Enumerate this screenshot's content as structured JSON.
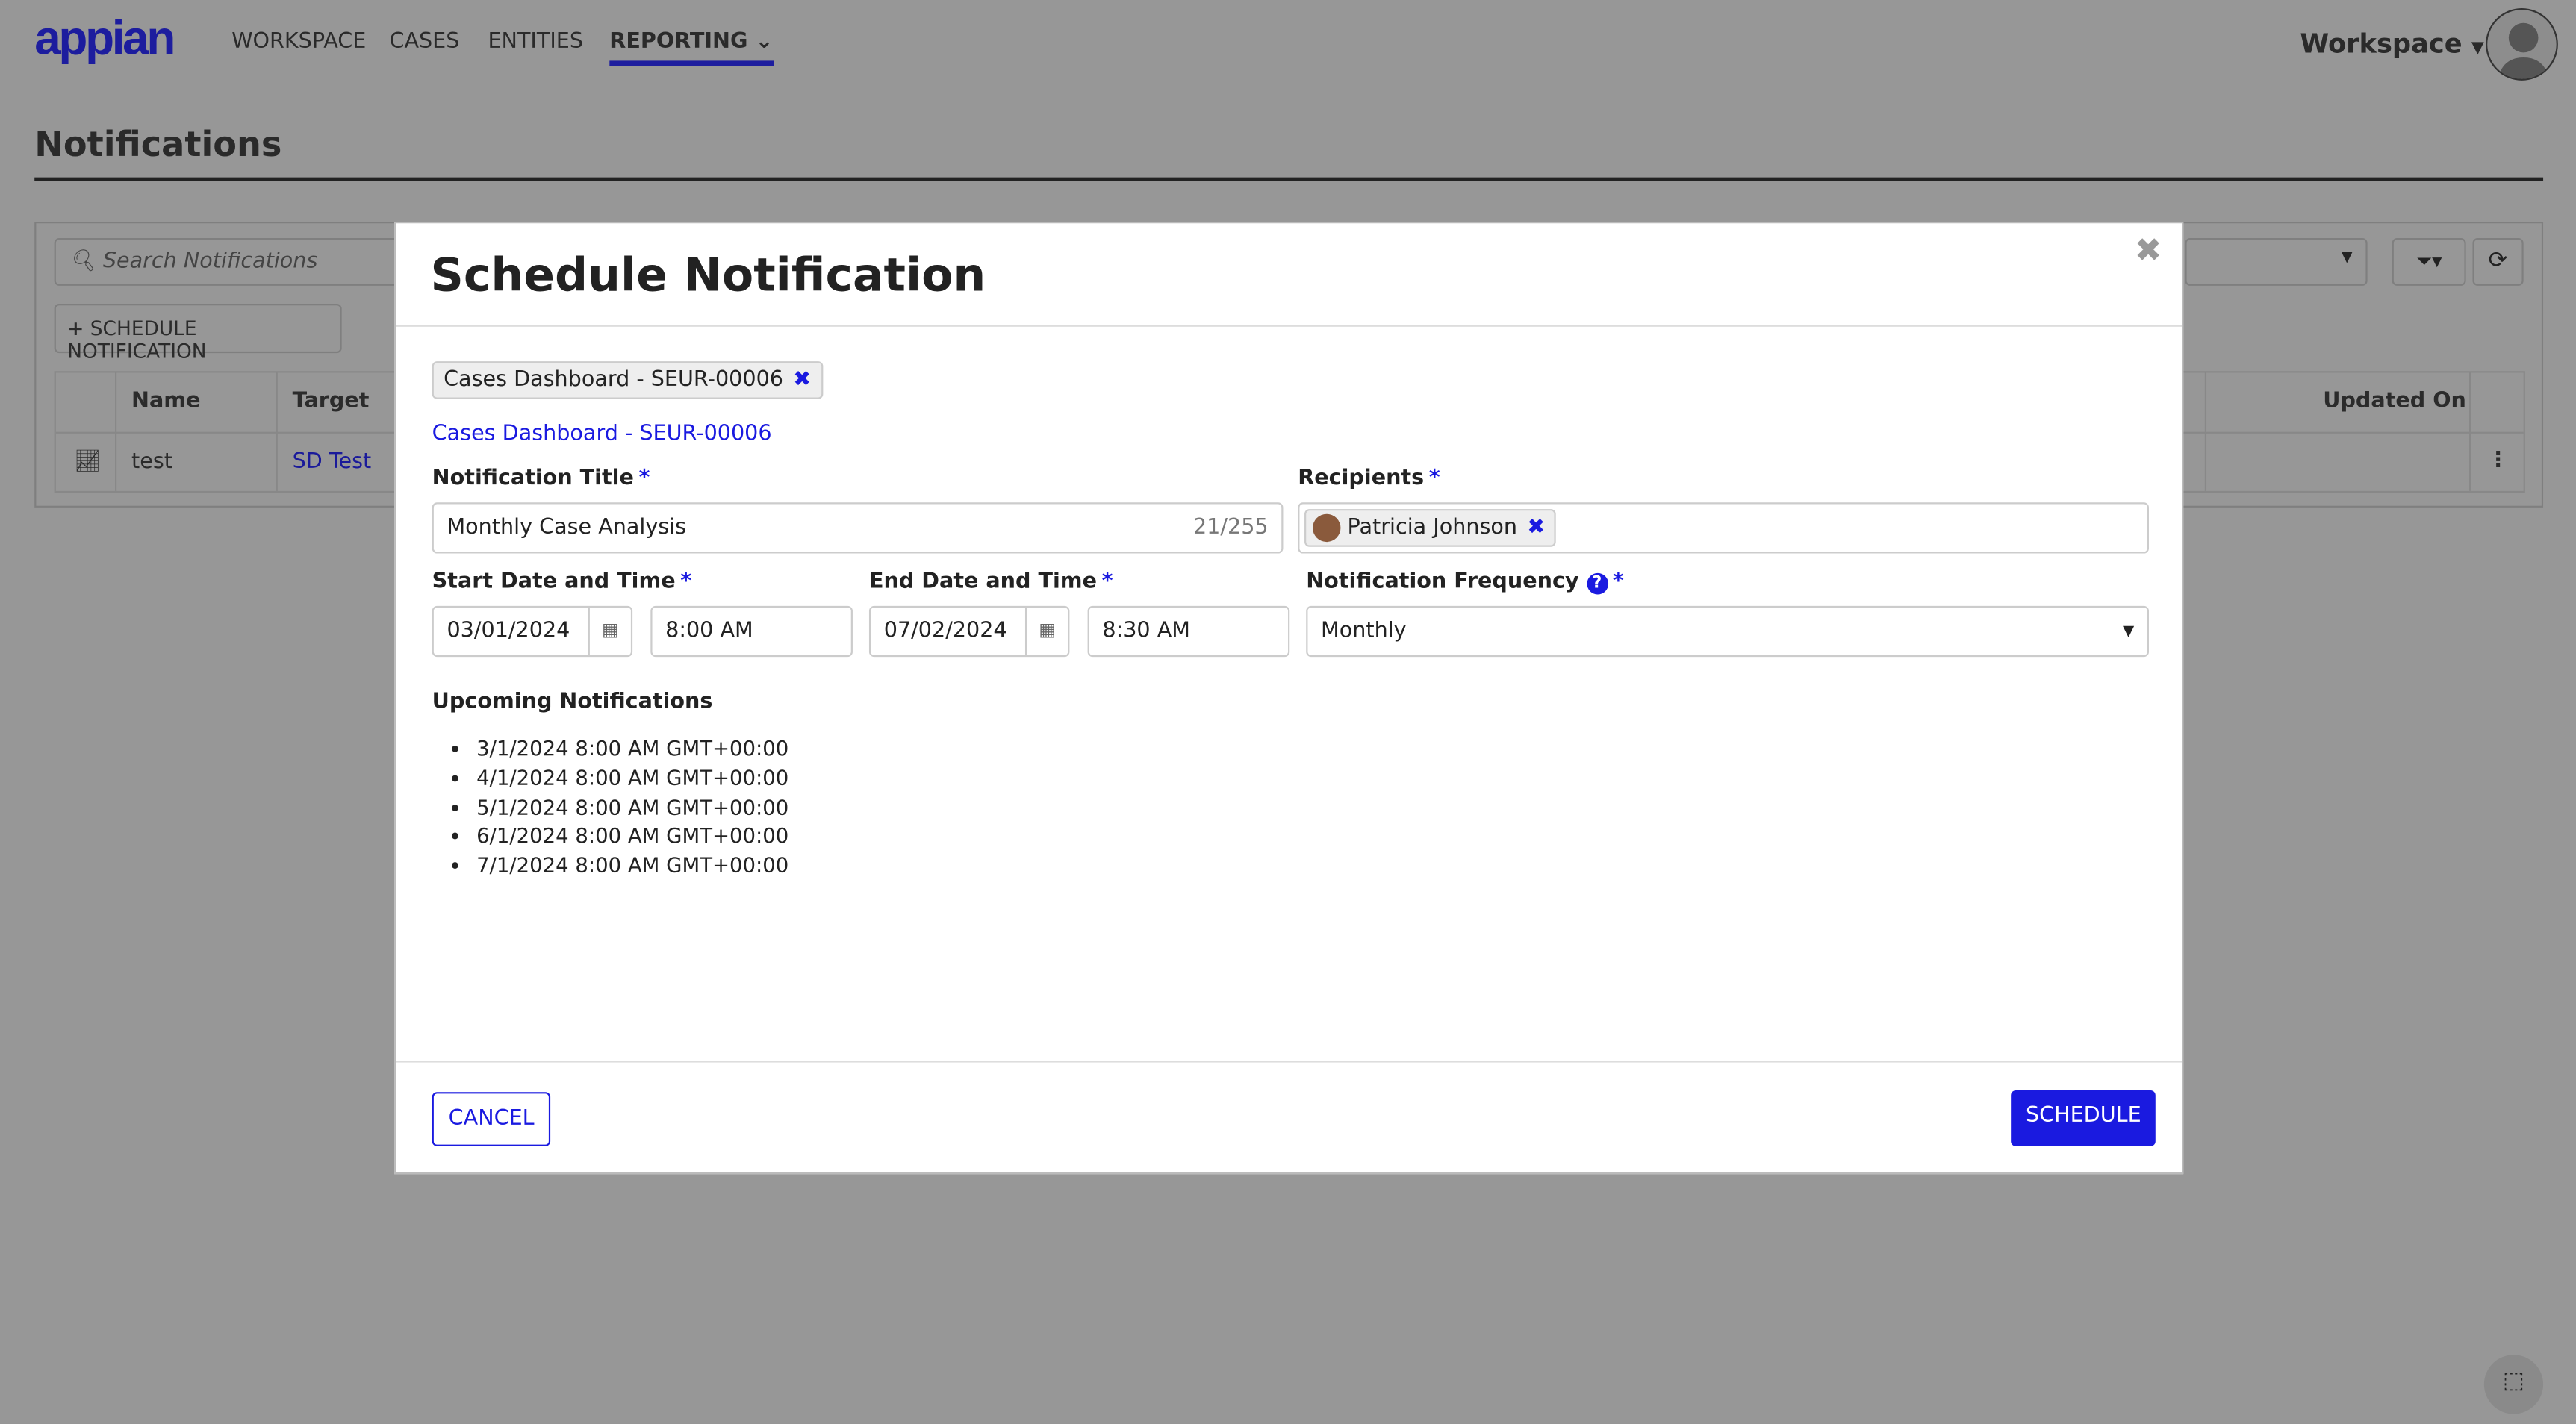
{
  "nav": {
    "logo": "appian",
    "items": [
      "WORKSPACE",
      "CASES",
      "ENTITIES",
      "REPORTING"
    ],
    "active": "REPORTING",
    "workspace": "Workspace"
  },
  "page": {
    "title": "Notifications",
    "search_placeholder": "Search Notifications",
    "schedule_button": "SCHEDULE NOTIFICATION",
    "table": {
      "headers": [
        "Name",
        "Target",
        "Updated On"
      ],
      "rows": [
        {
          "name": "test",
          "target": "SD Test"
        }
      ]
    }
  },
  "modal": {
    "title": "Schedule Notification",
    "close": "✖",
    "target_chip": "Cases Dashboard - SEUR-00006",
    "target_link": "Cases Dashboard - SEUR-00006",
    "title_label": "Notification Title",
    "title_value": "Monthly Case Analysis",
    "title_count": "21/255",
    "recipients_label": "Recipients",
    "recipient": "Patricia Johnson",
    "start_label": "Start Date and Time",
    "start_date": "03/01/2024",
    "start_time": "8:00 AM",
    "end_label": "End Date and Time",
    "end_date": "07/02/2024",
    "end_time": "8:30 AM",
    "freq_label": "Notification Frequency",
    "freq_value": "Monthly",
    "upcoming_label": "Upcoming Notifications",
    "upcoming": [
      "3/1/2024 8:00 AM GMT+00:00",
      "4/1/2024 8:00 AM GMT+00:00",
      "5/1/2024 8:00 AM GMT+00:00",
      "6/1/2024 8:00 AM GMT+00:00",
      "7/1/2024 8:00 AM GMT+00:00"
    ],
    "cancel": "CANCEL",
    "schedule": "SCHEDULE",
    "required": "*"
  },
  "colors": {
    "accent": "#1a1ae0",
    "brand": "#1d1d9e",
    "overlay": "#979797"
  }
}
